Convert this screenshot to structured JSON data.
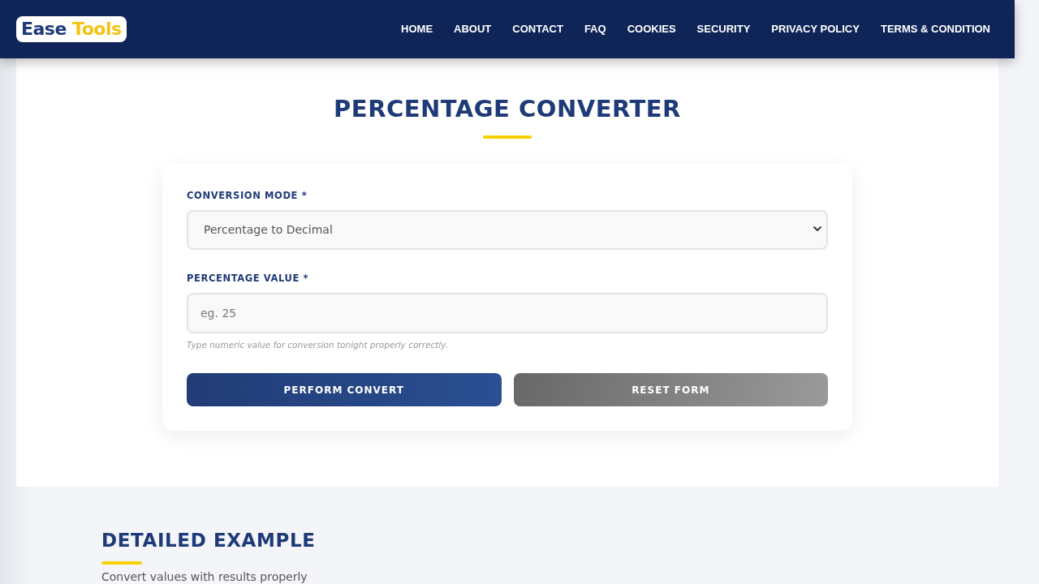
{
  "header": {
    "logo": {
      "parts": [
        "Ease",
        "Tools"
      ]
    },
    "nav": [
      "HOME",
      "ABOUT",
      "CONTACT",
      "FAQ",
      "COOKIES",
      "SECURITY",
      "PRIVACY POLICY",
      "TERMS & CONDITION"
    ]
  },
  "converter": {
    "title": "PERCENTAGE CONVERTER",
    "fields": [
      {
        "kind": "select",
        "label": "CONVERSION MODE *",
        "value": "Percentage to Decimal"
      },
      {
        "kind": "input",
        "label": "PERCENTAGE VALUE *",
        "placeholder": "eg. 25",
        "help": "Type numeric value for conversion tonight properly correctly."
      }
    ],
    "buttons": [
      {
        "kind": "primary",
        "label": "PERFORM CONVERT"
      },
      {
        "kind": "secondary",
        "label": "RESET FORM"
      }
    ]
  },
  "example": {
    "title": "DETAILED EXAMPLE",
    "text": "Convert values with results properly"
  }
}
